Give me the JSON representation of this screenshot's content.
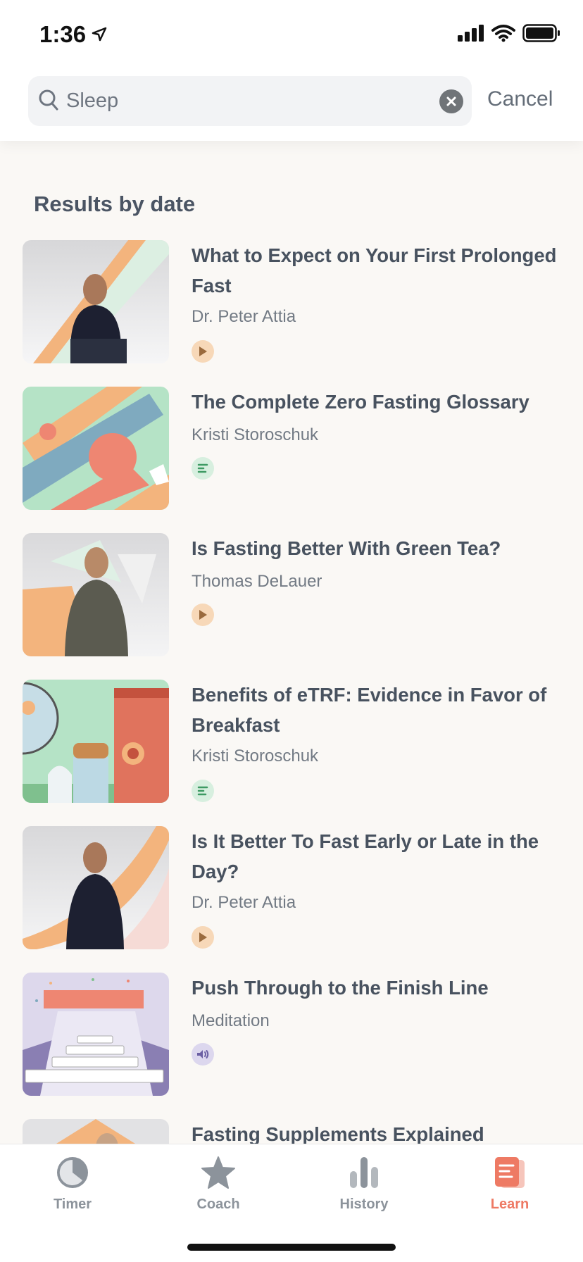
{
  "status": {
    "time": "1:36"
  },
  "search": {
    "value": "Sleep",
    "cancel_label": "Cancel"
  },
  "section_title": "Results by date",
  "results": [
    {
      "title": "What to Expect on Your First Prolonged Fast",
      "author": "Dr. Peter Attia",
      "type": "video"
    },
    {
      "title": "The Complete Zero Fasting Glossary",
      "author": "Kristi Storoschuk",
      "type": "article"
    },
    {
      "title": "Is Fasting Better With Green Tea?",
      "author": "Thomas DeLauer",
      "type": "video"
    },
    {
      "title": "Benefits of eTRF: Evidence in Favor of Breakfast",
      "author": "Kristi Storoschuk",
      "type": "article"
    },
    {
      "title": "Is It Better To Fast Early or Late in the Day?",
      "author": "Dr. Peter Attia",
      "type": "video"
    },
    {
      "title": "Push Through to the Finish Line",
      "author": "Meditation",
      "type": "audio"
    },
    {
      "title": "Fasting Supplements Explained",
      "author": "",
      "type": "video"
    }
  ],
  "tabs": [
    {
      "label": "Timer",
      "icon": "timer-icon"
    },
    {
      "label": "Coach",
      "icon": "star-icon"
    },
    {
      "label": "History",
      "icon": "bar-chart-icon"
    },
    {
      "label": "Learn",
      "icon": "book-icon",
      "active": true
    }
  ],
  "colors": {
    "accent": "#ee7a64",
    "video_badge": "#f7d8b8",
    "article_badge": "#d7efdf",
    "audio_badge": "#dcd7ee"
  }
}
